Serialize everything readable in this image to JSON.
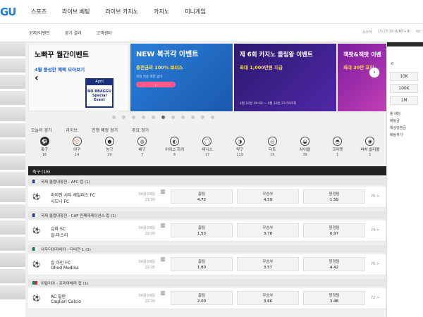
{
  "logo": "GU",
  "main_nav": [
    "스포츠",
    "라이브 베팅",
    "라이브 카지노",
    "카지노",
    "미니게임"
  ],
  "sub_nav": [
    "",
    "공지/이벤트",
    "경기 결과",
    "고객센터"
  ],
  "sub_right": {
    "odds_label": "소수식",
    "time": "15:27:19 (GMT+9)",
    "lang": "ko"
  },
  "banners": [
    {
      "title": "노빠꾸 월간이벤트",
      "sub": "4월 풍성한 혜택 모아보기",
      "cal_month": "April",
      "cal_text": "NO BBAGGU Special Event"
    },
    {
      "title": "NEW 복귀각 이벤트",
      "sub": "충전금의 100% 보너스",
      "small": "최대 적용 제한 없이"
    },
    {
      "title": "제 6회 카지노 롤링왕 이벤트",
      "sub": "최대 1,000만원 지급",
      "small": "4월 10일 00:00 ~ 4월 30일 23:59까지"
    },
    {
      "title": "잭팟&잭팟 이벤",
      "sub": "최대 30만 포인",
      "small": ""
    }
  ],
  "banner_dots": 11,
  "banner_active_dot": 5,
  "sport_tabs": [
    "오늘의 경기",
    "라이브",
    "진행 예정 경기",
    "주요 경기"
  ],
  "sports": [
    {
      "name": "축구",
      "count": "16",
      "icon": "soccer-icon",
      "glyph": "⚽"
    },
    {
      "name": "야구",
      "count": "14",
      "icon": "baseball-icon",
      "glyph": "⚾"
    },
    {
      "name": "농구",
      "count": "29",
      "icon": "basketball-icon",
      "glyph": "●"
    },
    {
      "name": "배구",
      "count": "7",
      "icon": "volleyball-icon",
      "glyph": "◍"
    },
    {
      "name": "아이스 하키",
      "count": "6",
      "icon": "hockey-icon",
      "glyph": "◐"
    },
    {
      "name": "테니스",
      "count": "17",
      "icon": "tennis-icon",
      "glyph": "◯"
    },
    {
      "name": "탁구",
      "count": "119",
      "icon": "table-tennis-icon",
      "glyph": "◑"
    },
    {
      "name": "다트",
      "count": "15",
      "icon": "darts-icon",
      "glyph": "◎"
    },
    {
      "name": "사이클",
      "count": "39",
      "icon": "cycling-icon",
      "glyph": "◒"
    },
    {
      "name": "크리켓",
      "count": "1",
      "icon": "cricket-icon",
      "glyph": "◓"
    },
    {
      "name": "비치 발리볼",
      "count": "1",
      "icon": "beach-volleyball-icon",
      "glyph": "◉"
    }
  ],
  "section_header": "축구 (16)",
  "matches": [
    {
      "league": "국제 클럽대항전 - AFC 컵 (1)",
      "home": "라이언 시티 세일러스 FC",
      "away": "시드니 FC",
      "date": "04월 09일",
      "time": "21:00",
      "odds": [
        {
          "label": "홈팀",
          "value": "4.72"
        },
        {
          "label": "무승부",
          "value": "4.59"
        },
        {
          "label": "원정팀",
          "value": "1.59"
        }
      ],
      "more": "76 >"
    },
    {
      "league": "국제 클럽대항전 - CAF 컨페데레이션스 컵 (1)",
      "home": "심바 SC",
      "away": "알-마스리",
      "date": "04월 09일",
      "time": "22:00",
      "odds": [
        {
          "label": "홈팀",
          "value": "1.53"
        },
        {
          "label": "무승부",
          "value": "3.78"
        },
        {
          "label": "원정팀",
          "value": "6.97"
        }
      ],
      "more": "74 >"
    },
    {
      "league": "사우디아라비아 - 디비전 1 (1)",
      "home": "알 아인 FC",
      "away": "Ohod Medina",
      "date": "04월 09일",
      "time": "22:05",
      "odds": [
        {
          "label": "홈팀",
          "value": "1.80"
        },
        {
          "label": "무승부",
          "value": "3.57"
        },
        {
          "label": "원정팀",
          "value": "4.42"
        }
      ],
      "more": "76 >"
    },
    {
      "league": "이탈리아 - 프리마베라 컵 (1)",
      "home": "AC 밀란",
      "away": "Cagliari Calcio",
      "date": "04월 09일",
      "time": "22:00",
      "odds": [
        {
          "label": "홈팀",
          "value": "2.00"
        },
        {
          "label": "무승부",
          "value": "3.66"
        },
        {
          "label": "원정팀",
          "value": "3.48"
        }
      ],
      "more": "72 >"
    }
  ],
  "right_panel": {
    "zero": "0",
    "btns": [
      "10K",
      "100K",
      "1M"
    ],
    "list": [
      "폴 배당",
      "베팅금",
      "예상당첨금",
      "베팅하기"
    ]
  }
}
